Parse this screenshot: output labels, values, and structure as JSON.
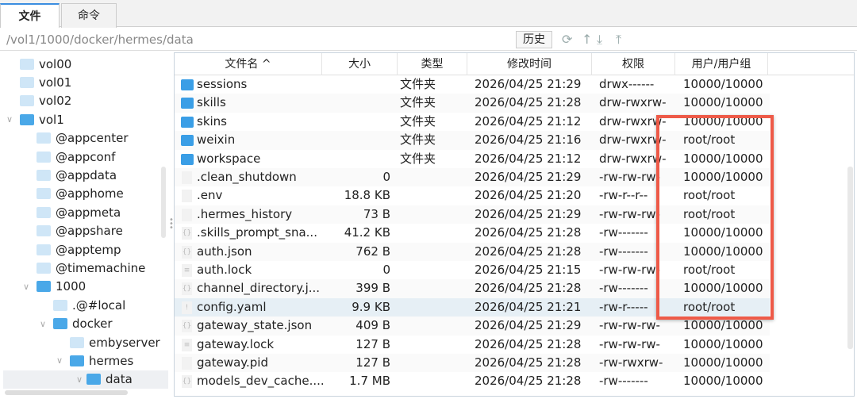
{
  "tabs": [
    {
      "label": "文件"
    },
    {
      "label": "命令"
    }
  ],
  "path": "/vol1/1000/docker/hermes/data",
  "toolbar": {
    "history": "历史",
    "icons": [
      "refresh-icon",
      "up-icon",
      "download-icon",
      "upload-icon"
    ]
  },
  "tree": [
    {
      "label": "vol00",
      "level": 0,
      "open": false
    },
    {
      "label": "vol01",
      "level": 0,
      "open": false
    },
    {
      "label": "vol02",
      "level": 0,
      "open": false
    },
    {
      "label": "vol1",
      "level": 0,
      "open": true
    },
    {
      "label": "@appcenter",
      "level": 1,
      "open": false
    },
    {
      "label": "@appconf",
      "level": 1,
      "open": false
    },
    {
      "label": "@appdata",
      "level": 1,
      "open": false
    },
    {
      "label": "@apphome",
      "level": 1,
      "open": false
    },
    {
      "label": "@appmeta",
      "level": 1,
      "open": false
    },
    {
      "label": "@appshare",
      "level": 1,
      "open": false
    },
    {
      "label": "@apptemp",
      "level": 1,
      "open": false
    },
    {
      "label": "@timemachine",
      "level": 1,
      "open": false
    },
    {
      "label": "1000",
      "level": 1,
      "open": true
    },
    {
      "label": ".@#local",
      "level": 2,
      "open": false
    },
    {
      "label": "docker",
      "level": 2,
      "open": true
    },
    {
      "label": "embyserver",
      "level": 3,
      "open": false
    },
    {
      "label": "hermes",
      "level": 3,
      "open": true
    },
    {
      "label": "data",
      "level": 4,
      "open": true,
      "selected": true
    }
  ],
  "columns": [
    "文件名 ^",
    "大小",
    "类型",
    "修改时间",
    "权限",
    "用户/用户组"
  ],
  "files": [
    {
      "name": "sessions",
      "size": "",
      "type": "文件夹",
      "time": "2026/04/25 21:29",
      "perm": "drwx------",
      "owner": "10000/10000",
      "icon": "folder"
    },
    {
      "name": "skills",
      "size": "",
      "type": "文件夹",
      "time": "2026/04/25 21:28",
      "perm": "drw-rwxrw-",
      "owner": "10000/10000",
      "icon": "folder"
    },
    {
      "name": "skins",
      "size": "",
      "type": "文件夹",
      "time": "2026/04/25 21:12",
      "perm": "drw-rwxrw-",
      "owner": "10000/10000",
      "icon": "folder"
    },
    {
      "name": "weixin",
      "size": "",
      "type": "文件夹",
      "time": "2026/04/25 21:16",
      "perm": "drw-rwxrw-",
      "owner": "root/root",
      "icon": "folder"
    },
    {
      "name": "workspace",
      "size": "",
      "type": "文件夹",
      "time": "2026/04/25 21:12",
      "perm": "drw-rwxrw-",
      "owner": "10000/10000",
      "icon": "folder"
    },
    {
      "name": ".clean_shutdown",
      "size": "0",
      "type": "",
      "time": "2026/04/25 21:29",
      "perm": "-rw-rw-rw-",
      "owner": "10000/10000",
      "icon": "file"
    },
    {
      "name": ".env",
      "size": "18.8 KB",
      "type": "",
      "time": "2026/04/25 21:20",
      "perm": "-rw-r--r--",
      "owner": "root/root",
      "icon": "file"
    },
    {
      "name": ".hermes_history",
      "size": "73 B",
      "type": "",
      "time": "2026/04/25 21:29",
      "perm": "-rw-rw-rw-",
      "owner": "root/root",
      "icon": "file"
    },
    {
      "name": ".skills_prompt_sna...",
      "size": "41.2 KB",
      "type": "",
      "time": "2026/04/25 21:28",
      "perm": "-rw-------",
      "owner": "10000/10000",
      "icon": "json"
    },
    {
      "name": "auth.json",
      "size": "762 B",
      "type": "",
      "time": "2026/04/25 21:28",
      "perm": "-rw-------",
      "owner": "10000/10000",
      "icon": "json"
    },
    {
      "name": "auth.lock",
      "size": "0",
      "type": "",
      "time": "2026/04/25 21:15",
      "perm": "-rw-rw-rw-",
      "owner": "root/root",
      "icon": "text"
    },
    {
      "name": "channel_directory.j...",
      "size": "399 B",
      "type": "",
      "time": "2026/04/25 21:28",
      "perm": "-rw-------",
      "owner": "10000/10000",
      "icon": "json"
    },
    {
      "name": "config.yaml",
      "size": "9.9 KB",
      "type": "",
      "time": "2026/04/25 21:21",
      "perm": "-rw-r-----",
      "owner": "root/root",
      "icon": "yaml",
      "selected": true
    },
    {
      "name": "gateway_state.json",
      "size": "409 B",
      "type": "",
      "time": "2026/04/25 21:29",
      "perm": "-rw-rw-rw-",
      "owner": "10000/10000",
      "icon": "json"
    },
    {
      "name": "gateway.lock",
      "size": "127 B",
      "type": "",
      "time": "2026/04/25 21:28",
      "perm": "-rw-rw-rw-",
      "owner": "10000/10000",
      "icon": "text"
    },
    {
      "name": "gateway.pid",
      "size": "127 B",
      "type": "",
      "time": "2026/04/25 21:28",
      "perm": "-rw-rwxrw-",
      "owner": "10000/10000",
      "icon": "file"
    },
    {
      "name": "models_dev_cache....",
      "size": "1.7 MB",
      "type": "",
      "time": "2026/04/25 21:28",
      "perm": "-rw-------",
      "owner": "10000/10000",
      "icon": "json"
    }
  ],
  "colors": {
    "accent": "#3b8ee0",
    "folder": "#3a9ee6",
    "highlight": "#ee5a48"
  }
}
